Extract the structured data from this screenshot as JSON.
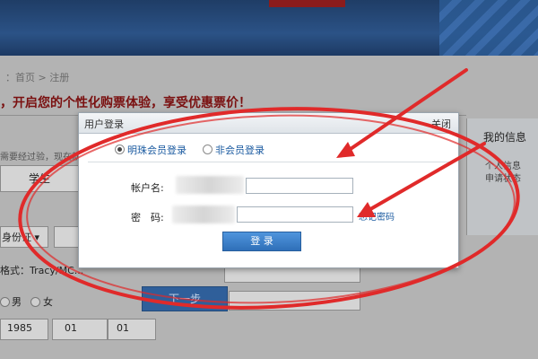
{
  "background": {
    "breadcrumb": "：首页 > 注册",
    "slogan": "，开启您的个性化购票体验，享受优惠票价！",
    "notice": "需要经过验，现在就吗",
    "side": {
      "title": "我的信息",
      "line1": "个人信息",
      "line2": "申请状态"
    },
    "passenger_type": "学生",
    "id_type": "身份证 ▾",
    "name_format": "格式：Tracy/MC...",
    "gender": {
      "male": "男",
      "female": "女"
    },
    "birth": {
      "year": "1985",
      "month": "01",
      "day": "01"
    },
    "next_button": "下一步"
  },
  "dialog": {
    "title": "用户登录",
    "close": "关闭",
    "tabs": [
      {
        "label": "明珠会员登录",
        "selected": true
      },
      {
        "label": "非会员登录",
        "selected": false
      }
    ],
    "account_label": "帐户名:",
    "password_label": "密　码:",
    "forgot_label": "忘记密码",
    "login_button": "登 录"
  },
  "colors": {
    "annotation": "#e02a2a",
    "banner": "#1f3d66",
    "link": "#1a5aa0",
    "button": "#2f6fb8"
  }
}
